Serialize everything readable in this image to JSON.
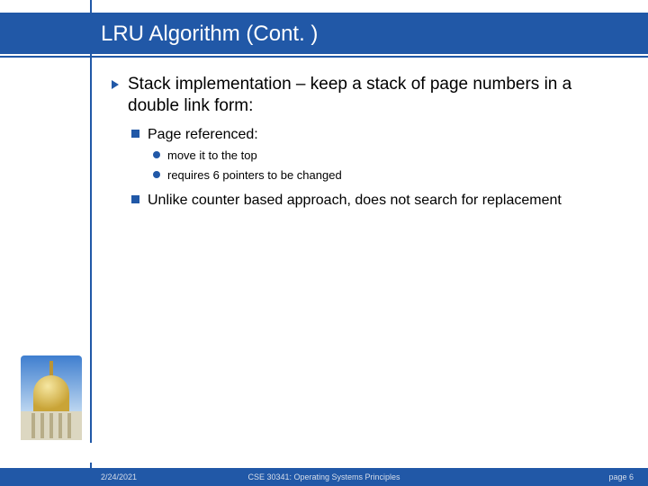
{
  "title": "LRU Algorithm (Cont. )",
  "body": {
    "l1": "Stack implementation – keep a stack of page numbers in a double link form:",
    "l2a": "Page referenced:",
    "l3a": "move it to the top",
    "l3b": "requires 6 pointers to be changed",
    "l2b": "Unlike counter based approach, does not search for replacement"
  },
  "footer": {
    "date": "2/24/2021",
    "course": "CSE 30341: Operating Systems Principles",
    "page": "page 6"
  }
}
